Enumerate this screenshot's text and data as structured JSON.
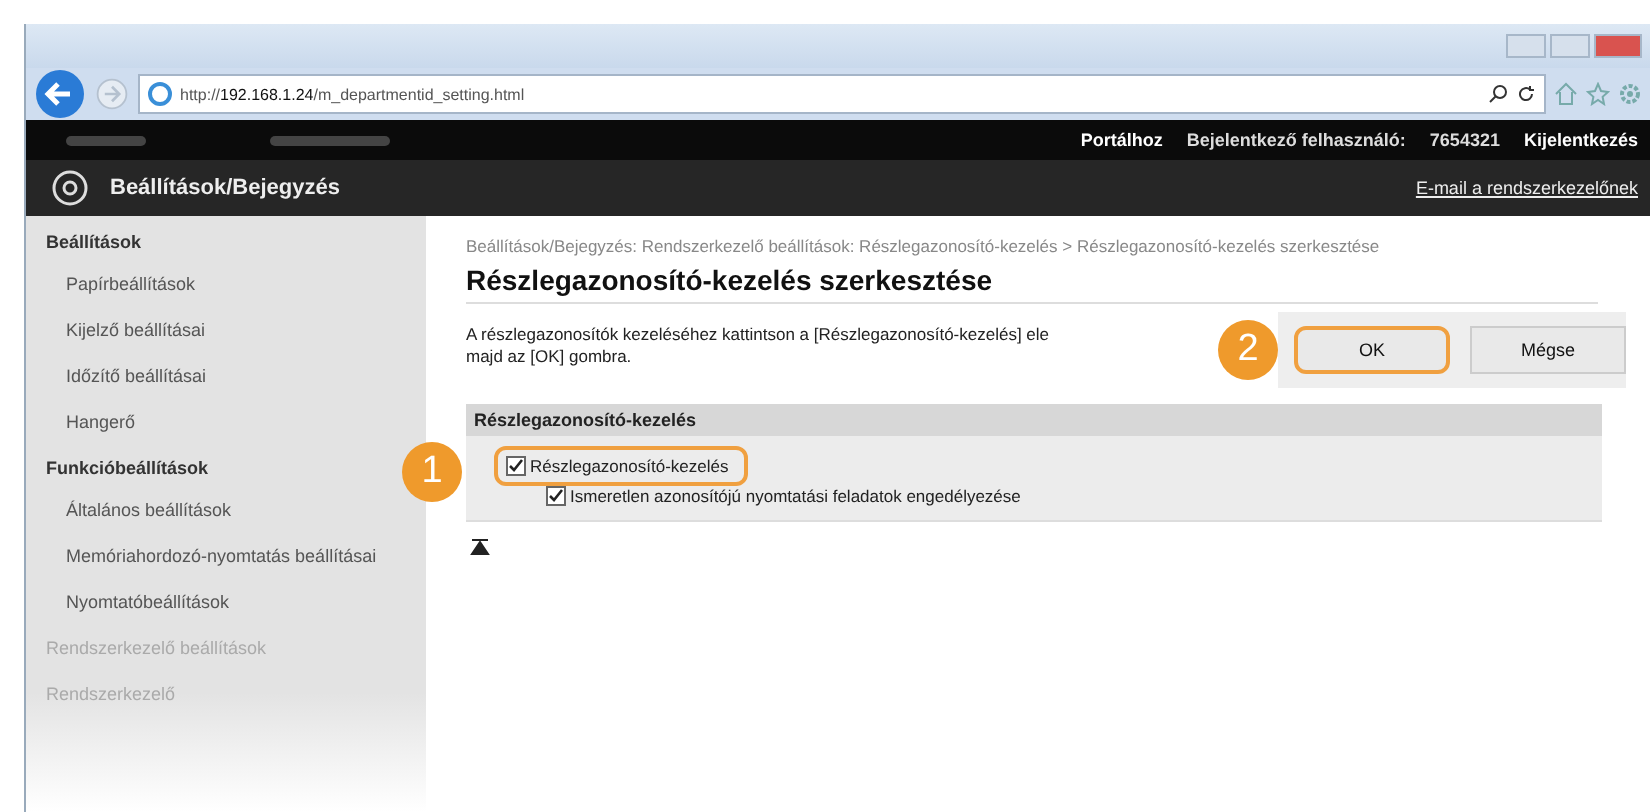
{
  "browser": {
    "url_host": "http://192.168.1.24",
    "url_path": "/m_departmentid_setting.html"
  },
  "top_bar": {
    "links": [
      {
        "label": "Portálhoz",
        "kind": "link"
      },
      {
        "label": "Bejelentkező felhasználó:",
        "kind": "text"
      },
      {
        "label": "7654321",
        "kind": "text"
      },
      {
        "label": "Kijelentkezés",
        "kind": "link"
      }
    ]
  },
  "header": {
    "title": "Beállítások/Bejegyzés",
    "mail_link": "E-mail a rendszerkezelőnek"
  },
  "sidebar": {
    "items": [
      {
        "label": "Beállítások",
        "kind": "heading"
      },
      {
        "label": "Papírbeállítások",
        "kind": "item"
      },
      {
        "label": "Kijelző beállításai",
        "kind": "item"
      },
      {
        "label": "Időzítő beállításai",
        "kind": "item"
      },
      {
        "label": "Hangerő",
        "kind": "item"
      },
      {
        "label": "Funkcióbeállítások",
        "kind": "heading"
      },
      {
        "label": "Általános beállítások",
        "kind": "item"
      },
      {
        "label": "Memóriahordozó-nyomtatás beállításai",
        "kind": "item"
      },
      {
        "label": "Nyomtatóbeállítások",
        "kind": "item"
      },
      {
        "label": "Rendszerkezelő beállítások",
        "kind": "faded"
      },
      {
        "label": "Rendszerkezelő",
        "kind": "faded"
      }
    ]
  },
  "content": {
    "breadcrumb": "Beállítások/Bejegyzés: Rendszerkezelő beállítások: Részlegazonosító-kezelés > Részlegazonosító-kezelés szerkesztése",
    "title": "Részlegazonosító-kezelés szerkesztése",
    "instruction": [
      "A részlegazonosítók kezeléséhez kattintson a [Részlegazonosító-kezelés] ele",
      "majd az [OK] gombra."
    ],
    "buttons": [
      {
        "label": "OK",
        "callout": "2"
      },
      {
        "label": "Mégse"
      }
    ],
    "section": {
      "title": "Részlegazonosító-kezelés",
      "options": [
        {
          "label": "Részlegazonosító-kezelés",
          "checked": true,
          "callout": "1",
          "kind": "main"
        },
        {
          "label": "Ismeretlen azonosítójú nyomtatási feladatok engedélyezése",
          "checked": true,
          "kind": "sub"
        }
      ]
    }
  }
}
